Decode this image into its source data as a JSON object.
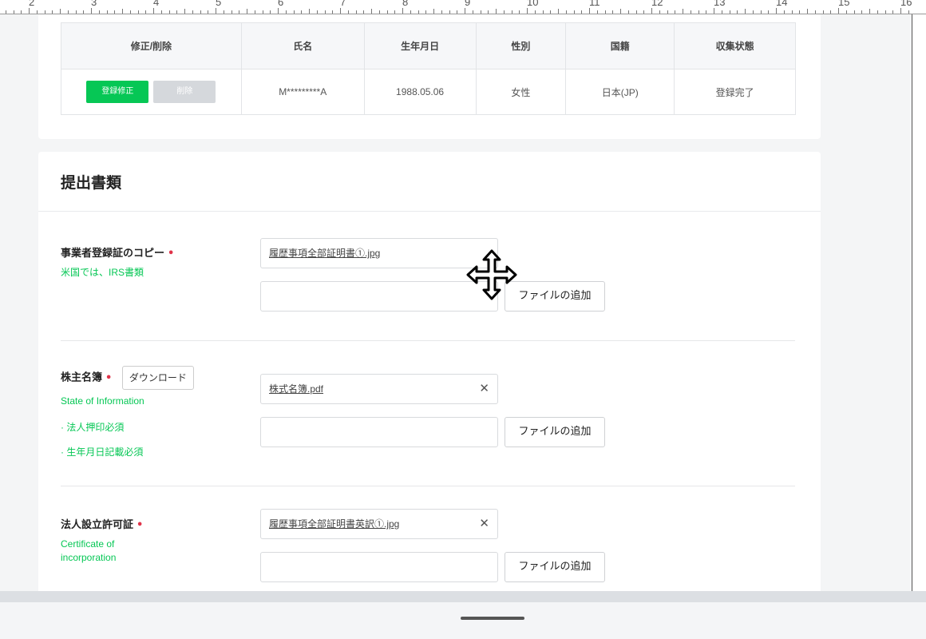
{
  "ruler": {
    "labels": [
      "2",
      "3",
      "4",
      "5",
      "6",
      "7",
      "8",
      "9",
      "10",
      "11",
      "12",
      "13",
      "14",
      "15",
      "16"
    ]
  },
  "members_table": {
    "headers": [
      "修正/削除",
      "氏名",
      "生年月日",
      "性別",
      "国籍",
      "収集状態"
    ],
    "rows": [
      {
        "edit_label": "登録修正",
        "delete_label": "削除",
        "name": "M*********A",
        "birthdate": "1988.05.06",
        "gender": "女性",
        "nationality": "日本(JP)",
        "status": "登録完了"
      }
    ]
  },
  "docs": {
    "title": "提出書類",
    "add_file_label": "ファイルの追加",
    "items": [
      {
        "label": "事業者登録証のコピー",
        "required_mark": "•",
        "sub": [
          "米国では、IRS書類"
        ],
        "file": "履歴事項全部証明書①.jpg"
      },
      {
        "label": "株主名簿",
        "required_mark": "•",
        "download_label": "ダウンロード",
        "sub": [
          "State of Information",
          "· 法人押印必須",
          "· 生年月日記載必須"
        ],
        "file": "株式名簿.pdf"
      },
      {
        "label": "法人設立許可証",
        "required_mark": "•",
        "sub": [
          "Certificate of",
          "incorporation"
        ],
        "file": "履歴事項全部証明書英訳①.jpg"
      }
    ]
  },
  "colors": {
    "accent_green": "#06c755",
    "required_red": "#e0344a"
  },
  "cursor": {
    "icon": "move-cursor-icon"
  }
}
